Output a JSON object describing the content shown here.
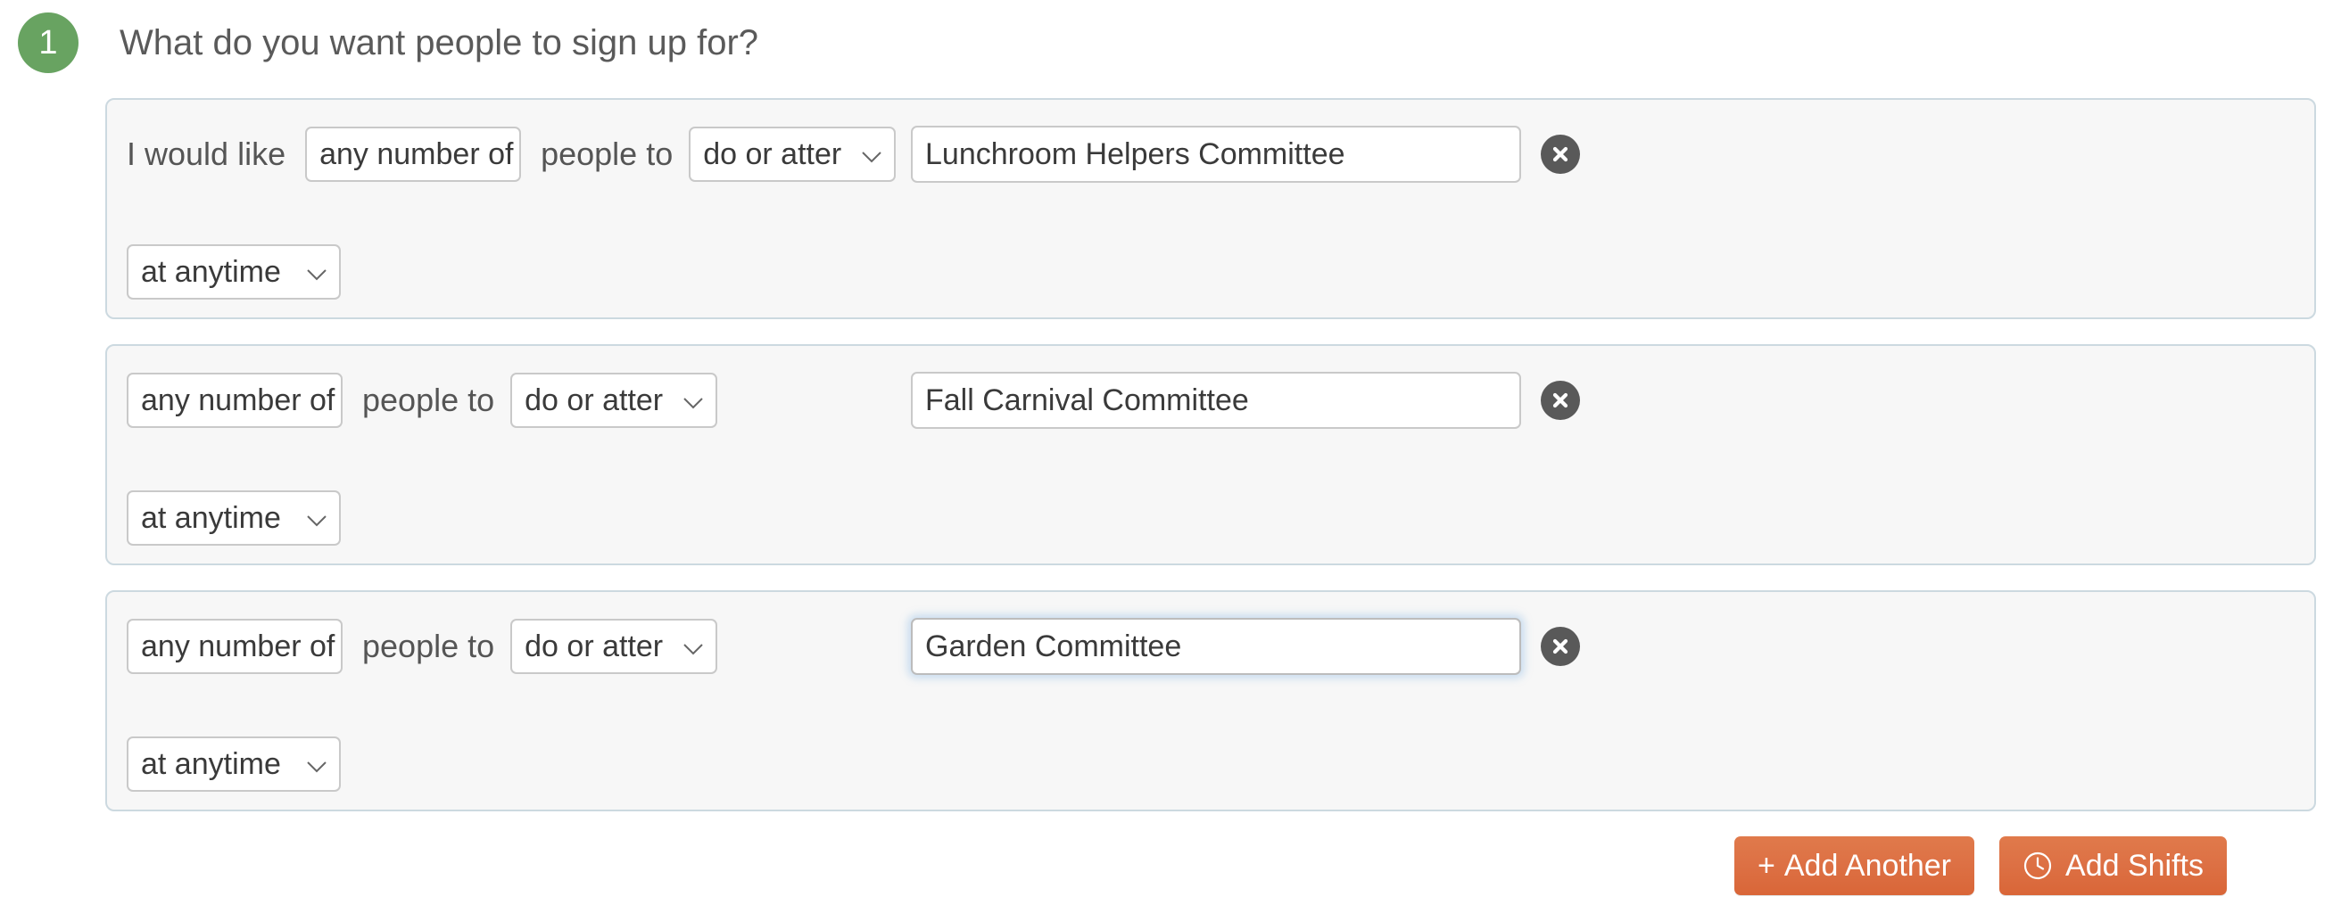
{
  "step": {
    "number": "1",
    "badge_color": "#68a361",
    "title": "What do you want people to sign up for?"
  },
  "labels": {
    "prefix": "I would like",
    "people_to": "people to"
  },
  "rows": [
    {
      "show_prefix": true,
      "quantity": "any number of",
      "verb": "do or atter",
      "name": "Lunchroom Helpers Committee",
      "when": "at anytime",
      "focused": false,
      "remove_label": "remove"
    },
    {
      "show_prefix": false,
      "quantity": "any number of",
      "verb": "do or atter",
      "name": "Fall Carnival Committee",
      "when": "at anytime",
      "focused": false,
      "remove_label": "remove"
    },
    {
      "show_prefix": false,
      "quantity": "any number of",
      "verb": "do or atter",
      "name": "Garden Committee",
      "when": "at anytime",
      "focused": true,
      "remove_label": "remove"
    }
  ],
  "footer": {
    "add_another_plus": "+",
    "add_another_label": "Add Another",
    "add_shifts_label": "Add Shifts",
    "button_color": "#dd7145"
  }
}
